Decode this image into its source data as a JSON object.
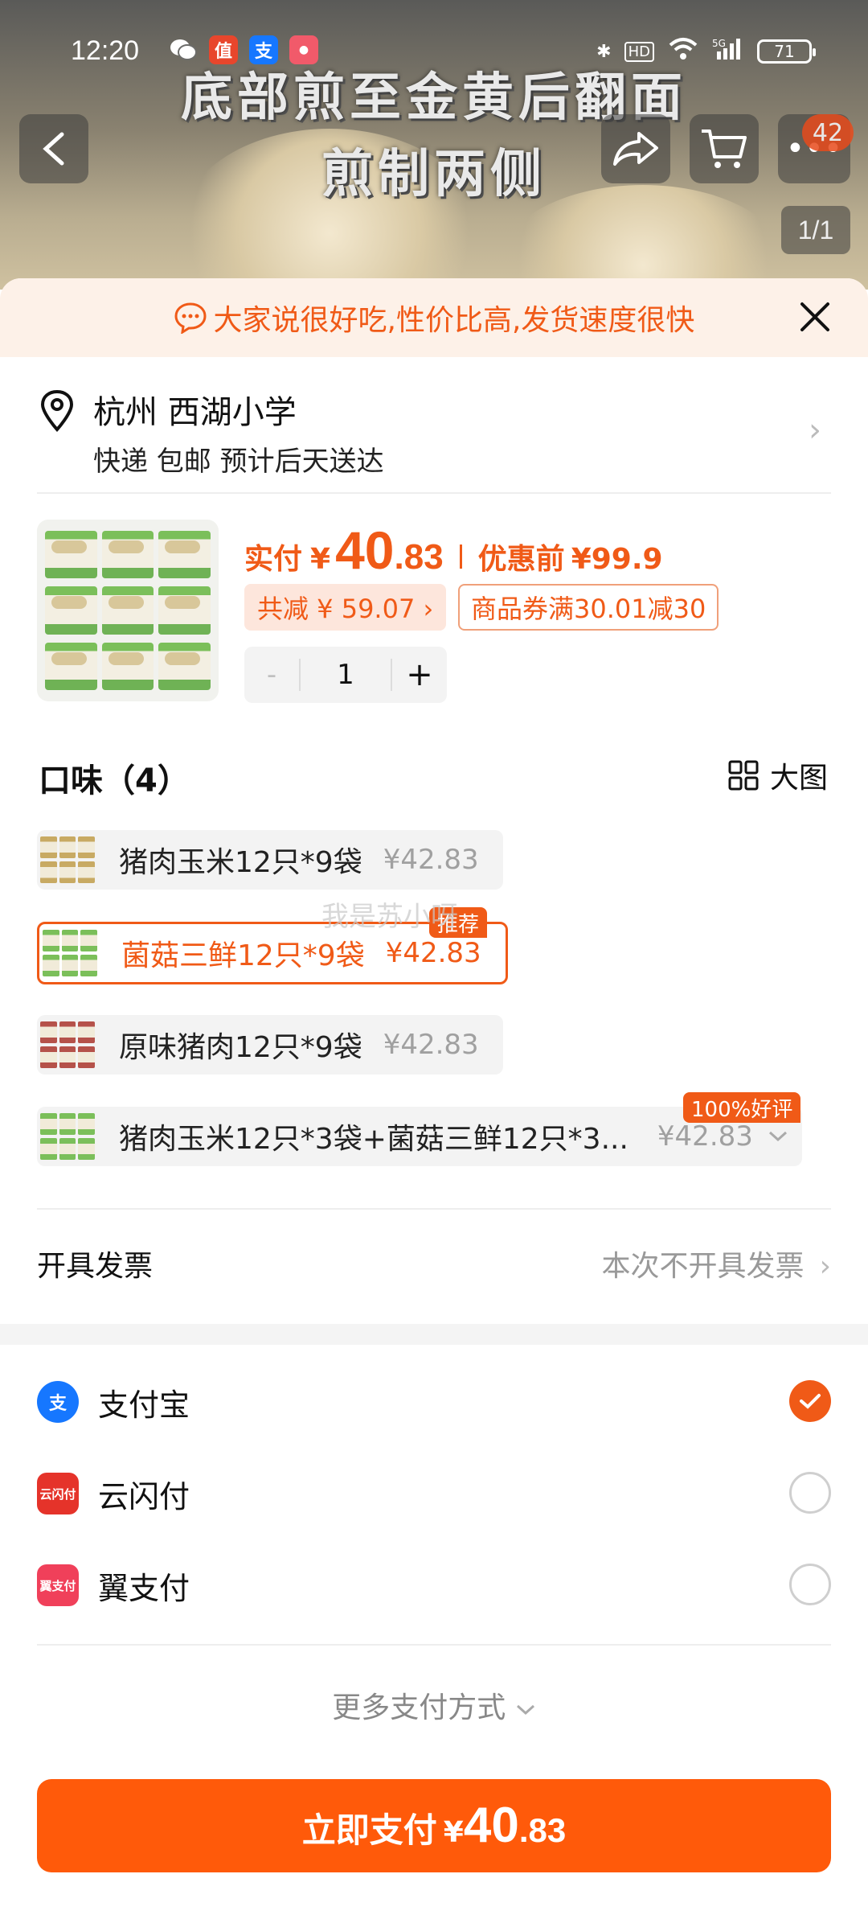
{
  "video": {
    "caption_line1": "底部煎至金黄后翻面",
    "caption_line2": "煎制两侧",
    "cart_badge": "42",
    "pager": "1/1"
  },
  "status_bar": {
    "time": "12:20",
    "battery": "71",
    "app_icons": [
      "wechat",
      "值",
      "支",
      "app"
    ]
  },
  "banner": {
    "text": "大家说很好吃,性价比高,发货速度很快"
  },
  "address": {
    "city": "杭州 西湖小学",
    "shipping": "快递 包邮 预计后天送达"
  },
  "price": {
    "pay_label": "实付",
    "currency": "¥",
    "pay_int": "40",
    "pay_dec": ".83",
    "before_label": "优惠前",
    "before_value": "¥99.9",
    "discount_tag": "共减 ¥ 59.07 ›",
    "coupon_tag": "商品券满30.01减30"
  },
  "quantity": {
    "minus": "-",
    "value": "1",
    "plus": "+"
  },
  "flavors": {
    "title": "口味（4）",
    "big_pic_label": "大图",
    "items": [
      {
        "name": "猪肉玉米12只*9袋",
        "price": "¥42.83"
      },
      {
        "name": "菌菇三鲜12只*9袋",
        "price": "¥42.83",
        "tag": "推荐"
      },
      {
        "name": "原味猪肉12只*9袋",
        "price": "¥42.83"
      },
      {
        "name": "猪肉玉米12只*3袋+菌菇三鲜12只*3...",
        "price": "¥42.83",
        "tag": "100%好评"
      }
    ],
    "watermark": "我是苏小呀"
  },
  "invoice": {
    "label": "开具发票",
    "value": "本次不开具发票"
  },
  "payment_methods": [
    {
      "name": "支付宝",
      "icon": "alipay-icon",
      "color": "#1677ff",
      "selected": true
    },
    {
      "name": "云闪付",
      "icon": "unionpay-icon",
      "color": "#e5332a",
      "selected": false
    },
    {
      "name": "翼支付",
      "icon": "bestpay-icon",
      "color": "#f0405a",
      "selected": false
    }
  ],
  "more_payment": "更多支付方式",
  "pay_button": {
    "label": "立即支付",
    "currency": "¥",
    "int": "40",
    "dec": ".83"
  },
  "colors": {
    "accent": "#f05a17",
    "button": "#ff5a0a"
  }
}
